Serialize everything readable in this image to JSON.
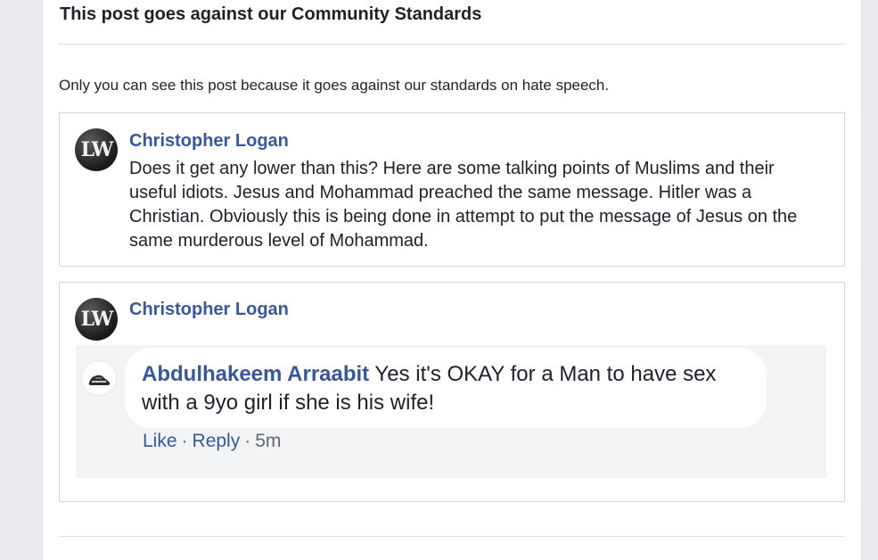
{
  "notice_title": "This post goes against our Community Standards",
  "notice_text": "Only you can see this post because it goes against our standards on hate speech.",
  "post1": {
    "avatar_initials": "LW",
    "author": "Christopher Logan",
    "text": "Does it get any lower than this? Here are some talking points of Muslims and their useful idiots. Jesus and Mohammad preached the same message. Hitler was a Christian. Obviously this is being done in attempt to put the message of Jesus on the same murderous level of Mohammad."
  },
  "post2": {
    "avatar_initials": "LW",
    "author": "Christopher Logan",
    "shared_comment": {
      "author": "Abdulhakeem Arraabit",
      "text": "Yes it's OKAY for a Man to have sex with a 9yo girl if she is his wife!",
      "like_label": "Like",
      "separator": "·",
      "reply_label": "Reply",
      "time": "5m"
    }
  },
  "colors": {
    "link_blue": "#385898",
    "page_bg": "#e9ebee",
    "card_border": "#d3d6db"
  }
}
